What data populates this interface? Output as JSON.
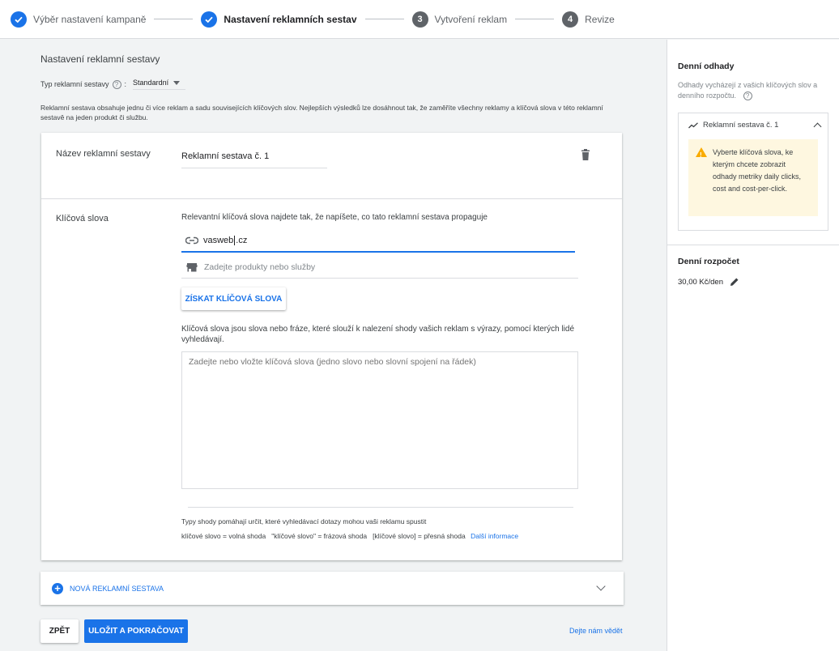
{
  "stepper": {
    "steps": [
      {
        "label": "Výběr nastavení kampaně",
        "state": "done"
      },
      {
        "label": "Nastavení reklamních sestav",
        "state": "active"
      },
      {
        "label": "Vytvoření reklam",
        "state": "todo",
        "number": "3"
      },
      {
        "label": "Revize",
        "state": "todo",
        "number": "4"
      }
    ]
  },
  "main": {
    "section_title": "Nastavení reklamní sestavy",
    "type_label": "Typ reklamní sestavy",
    "type_value": "Standardní",
    "description": "Reklamní sestava obsahuje jednu či více reklam a sadu souvisejících klíčových slov. Nejlepších výsledků lze dosáhnout tak, že zaměříte všechny reklamy a klíčová slova v této reklamní sestavě na jeden produkt či službu.",
    "card": {
      "name_label": "Název reklamní sestavy",
      "name_value": "Reklamní sestava č. 1",
      "keywords_label": "Klíčová slova",
      "keywords_help": "Relevantní klíčová slova najdete tak, že napíšete, co tato reklamní sestava propaguje",
      "url_value_before": "vasweb",
      "url_value_after": ".cz",
      "products_placeholder": "Zadejte produkty nebo služby",
      "get_keywords_button": "ZÍSKAT KLÍČOVÁ SLOVA",
      "keywords_desc": "Klíčová slova jsou slova nebo fráze, které slouží k nalezení shody vašich reklam s výrazy, pomocí kterých lidé vyhledávají.",
      "keywords_placeholder": "Zadejte nebo vložte klíčová slova (jedno slovo nebo slovní spojení na řádek)",
      "match_info": "Typy shody pomáhají určit, které vyhledávací dotazy mohou vaši reklamu spustit",
      "match_types": "klíčové slovo = volná shoda   \"klíčové slovo\" = frázová shoda   [klíčové slovo] = přesná shoda",
      "more_info_link": "Další informace"
    },
    "new_group_label": "NOVÁ REKLAMNÍ SESTAVA",
    "back_button": "ZPĚT",
    "save_button": "ULOŽIT A POKRAČOVAT",
    "feedback_link": "Dejte nám vědět"
  },
  "side": {
    "estimates_title": "Denní odhady",
    "estimates_sub": "Odhady vycházejí z vašich klíčových slov a denního rozpočtu.",
    "group_name": "Reklamní sestava č. 1",
    "warning": "Vyberte klíčová slova, ke kterým chcete zobrazit odhady metriky daily clicks, cost and cost-per-click.",
    "budget_title": "Denní rozpočet",
    "budget_value": "30,00 Kč/den"
  },
  "colors": {
    "accent": "#1a73e8",
    "warning_bg": "#fef7e0",
    "warning_icon": "#f9ab00"
  },
  "icons": [
    "check-icon",
    "help-icon",
    "trash-icon",
    "link-icon",
    "store-icon",
    "plus-icon",
    "chevron-down-icon",
    "trend-icon",
    "chevron-up-icon",
    "warning-icon",
    "pencil-icon"
  ]
}
